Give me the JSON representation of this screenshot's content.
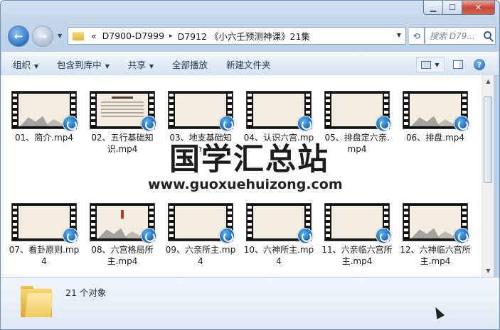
{
  "window": {
    "caption_buttons": {
      "minimize": "▁",
      "maximize": "☐",
      "close": "✕"
    }
  },
  "nav": {
    "back_glyph": "←",
    "forward_glyph": "→",
    "address": {
      "overflow": "«",
      "parts": [
        "D7900-D7999",
        "D7912 《小六壬预测神课》21集"
      ],
      "separator": "▸"
    },
    "search_placeholder": "搜索 D79..."
  },
  "toolbar": {
    "organize": "组织",
    "include_library": "包含到库中",
    "share": "共享",
    "play_all": "全部播放",
    "new_folder": "新建文件夹",
    "help_glyph": "?"
  },
  "files": [
    {
      "name": "01、简介.mp4",
      "scene": "mountain"
    },
    {
      "name": "02、五行基础知识.mp4",
      "scene": "text"
    },
    {
      "name": "03、地支基础知识.mp4",
      "scene": "blank"
    },
    {
      "name": "04、认识六宫.mp4",
      "scene": "blank"
    },
    {
      "name": "05、排盘定六亲.mp4",
      "scene": "blank"
    },
    {
      "name": "06、排盘.mp4",
      "scene": "mountain"
    },
    {
      "name": "07、看卦原则.mp4",
      "scene": "blank"
    },
    {
      "name": "08、六宫格局所主.mp4",
      "scene": "seal"
    },
    {
      "name": "09、六亲所主.mp4",
      "scene": "blank"
    },
    {
      "name": "10、六神所主.mp4",
      "scene": "blank"
    },
    {
      "name": "11、六亲临六宫所主.mp4",
      "scene": "blank"
    },
    {
      "name": "12、六神临六宫所主.mp4",
      "scene": "mountain"
    }
  ],
  "watermark": {
    "title": "国学汇总站",
    "url": "www.guoxuehuizong.com"
  },
  "details": {
    "object_count": "21 个对象"
  },
  "colors": {
    "accent": "#2e74c6",
    "toolbar_text": "#1e395b"
  }
}
